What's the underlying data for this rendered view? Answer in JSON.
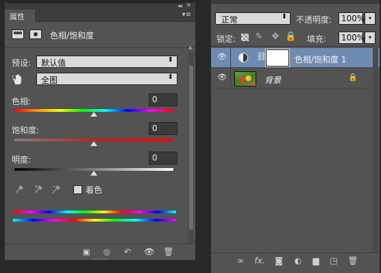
{
  "properties_panel": {
    "tab": "属性",
    "collapse_glyph": "◂◂",
    "close_glyph": "✕",
    "menu_glyph": "▾≡",
    "header_title": "色相/饱和度",
    "preset_label": "预设:",
    "preset_value": "默认值",
    "channel_value": "全图",
    "hue": {
      "label": "色相:",
      "value": "0",
      "level": 0.5
    },
    "saturation": {
      "label": "饱和度:",
      "value": "0",
      "level": 0.5
    },
    "lightness": {
      "label": "明度:",
      "value": "0",
      "level": 0.5
    },
    "colorize_label": "着色",
    "colorize_checked": false,
    "dropdown_arrow": "⬍",
    "eyedropper_glyphs": [
      "🖉",
      "🖉",
      "🖉"
    ],
    "footer_icons": {
      "clip": "▣",
      "prev_state": "◎",
      "reset": "↶",
      "visibility": "👁",
      "delete": "🗑"
    }
  },
  "layers_panel": {
    "blend_mode": "正常",
    "opacity_label": "不透明度:",
    "opacity_value": "100%",
    "lock_label": "锁定:",
    "fill_label": "填充:",
    "fill_value": "100%",
    "dropdown_glyph": "▾",
    "lock_icons": {
      "pixels": "✎",
      "position": "✥",
      "all": "🔒"
    },
    "layers": [
      {
        "name": "色相/饱和度 1",
        "visible_glyph": "👁",
        "selected": true,
        "type": "adjustment",
        "chain": "⛓"
      },
      {
        "name": "背景",
        "visible_glyph": "👁",
        "selected": false,
        "type": "image",
        "locked_glyph": "🔒"
      }
    ],
    "footer_icons": {
      "link": "∞",
      "fx": "fx.",
      "mask": "◙",
      "adjust": "◐",
      "group": "▆",
      "new_layer": "◳",
      "delete": "🗑"
    }
  },
  "colors": {
    "panel_bg": "#535353",
    "selected_layer": "#6f8bb1",
    "app_bg": "#282828"
  }
}
